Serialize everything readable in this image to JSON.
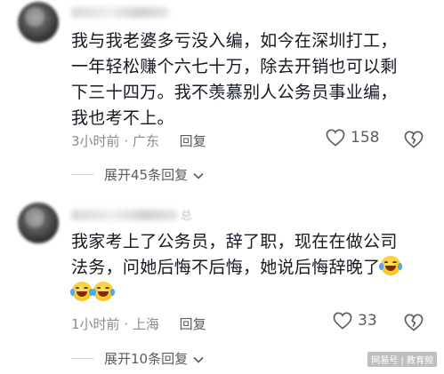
{
  "comments": [
    {
      "name_suffix": "",
      "text_lines": [
        "我与我老婆多亏没入编，如今在深圳打工，",
        "一年轻松赚个六七十万，除去开销也可以剩",
        "下三十四万。我不羡慕别人公务员事业编，",
        "我也考不上。"
      ],
      "time": "3小时前",
      "location": "广东",
      "reply_label": "回复",
      "likes": "158",
      "expand_label": "展开45条回复"
    },
    {
      "name_suffix": "总",
      "text_lines": [
        "我家考上了公务员，辞了职，现在在做公司",
        "法务，问她后悔不后悔，她说后悔辞晚了",
        ""
      ],
      "time": "1小时前",
      "location": "上海",
      "reply_label": "回复",
      "likes": "33",
      "expand_label": "展开10条回复"
    }
  ],
  "watermark": "网易号 | 教育频",
  "icons": {
    "like": "heart-outline-icon",
    "dislike": "broken-heart-icon",
    "expand": "chevron-down-icon",
    "emoji": "laughing-tears-emoji"
  }
}
